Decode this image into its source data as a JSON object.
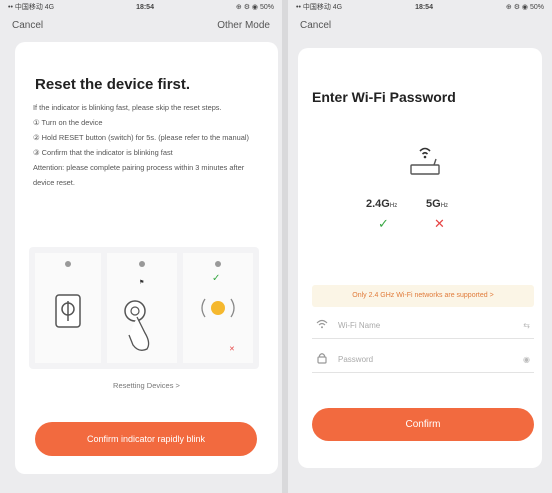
{
  "left": {
    "status": {
      "left": "•• 中国移动 4G",
      "time": "18:54",
      "right": "⊕ ⚙ ◉ 50%"
    },
    "cancel": "Cancel",
    "other_mode": "Other Mode",
    "title": "Reset the device first.",
    "steps": [
      "If the indicator is blinking fast, please skip the reset steps.",
      "① Turn on the device",
      "② Hold RESET button (switch) for 5s. (please refer to the manual)",
      "③ Confirm that the indicator is blinking fast",
      "Attention: please complete pairing process within 3 minutes after device reset."
    ],
    "reset_link": "Resetting Devices >",
    "confirm_button": "Confirm indicator rapidly blink"
  },
  "right": {
    "status": {
      "left": "•• 中国移动 4G",
      "time": "18:54",
      "right": "⊕ ⚙ ◉ 50%"
    },
    "cancel": "Cancel",
    "title": "Enter Wi-Fi Password",
    "band_24": "2.4G",
    "band_24_unit": "Hz",
    "band_5": "5G",
    "band_5_unit": "Hz",
    "notice": "Only 2.4 GHz Wi-Fi networks are supported >",
    "wifi_placeholder": "Wi-Fi Name",
    "wifi_switch": "⇆",
    "password_placeholder": "Password",
    "eye": "◉",
    "confirm_button": "Confirm"
  },
  "colors": {
    "accent": "#f26a3f",
    "ok": "#3aa845",
    "bad": "#e64545",
    "notice_text": "#e07b3a"
  }
}
